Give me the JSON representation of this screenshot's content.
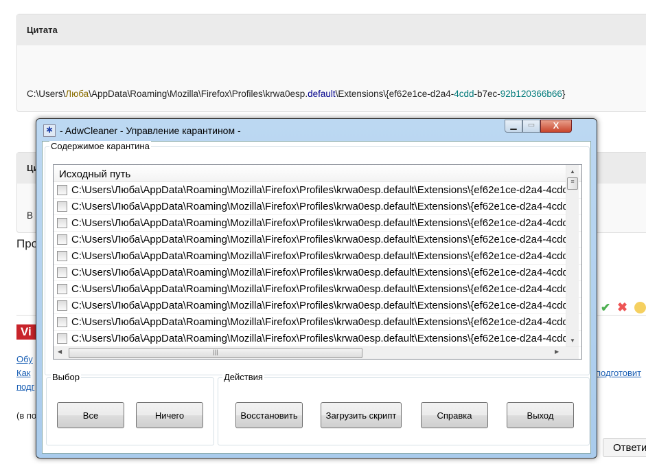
{
  "page": {
    "quote1": {
      "header": "Цитата",
      "path_parts": [
        "C:\\Users\\",
        "Люба",
        "\\AppData\\Roaming\\Mozilla\\Firefox\\Profiles\\krwa0esp.",
        "default",
        "\\Extensions\\{ef62e1ce-d2a4-",
        "4cdd",
        "-b7ec-",
        "92b120366b66",
        "}"
      ]
    },
    "quote2": {
      "header": "Ци",
      "text": "В"
    },
    "pro_text": "Про",
    "logo_text": "Vi",
    "links": [
      "Обу",
      "Как",
      "подг"
    ],
    "link_right": "подготовит",
    "paren_text": "(в по",
    "reply_button": "Ответи"
  },
  "dialog": {
    "title": "- AdwCleaner - Управление карантином -",
    "quarantine_group": "Содержимое карантина",
    "column_header": "Исходный путь",
    "rows": [
      "C:\\Users\\Люба\\AppData\\Roaming\\Mozilla\\Firefox\\Profiles\\krwa0esp.default\\Extensions\\{ef62e1ce-d2a4-4cdd",
      "C:\\Users\\Люба\\AppData\\Roaming\\Mozilla\\Firefox\\Profiles\\krwa0esp.default\\Extensions\\{ef62e1ce-d2a4-4cdd",
      "C:\\Users\\Люба\\AppData\\Roaming\\Mozilla\\Firefox\\Profiles\\krwa0esp.default\\Extensions\\{ef62e1ce-d2a4-4cdd",
      "C:\\Users\\Люба\\AppData\\Roaming\\Mozilla\\Firefox\\Profiles\\krwa0esp.default\\Extensions\\{ef62e1ce-d2a4-4cdd",
      "C:\\Users\\Люба\\AppData\\Roaming\\Mozilla\\Firefox\\Profiles\\krwa0esp.default\\Extensions\\{ef62e1ce-d2a4-4cdd",
      "C:\\Users\\Люба\\AppData\\Roaming\\Mozilla\\Firefox\\Profiles\\krwa0esp.default\\Extensions\\{ef62e1ce-d2a4-4cdd",
      "C:\\Users\\Люба\\AppData\\Roaming\\Mozilla\\Firefox\\Profiles\\krwa0esp.default\\Extensions\\{ef62e1ce-d2a4-4cdd",
      "C:\\Users\\Люба\\AppData\\Roaming\\Mozilla\\Firefox\\Profiles\\krwa0esp.default\\Extensions\\{ef62e1ce-d2a4-4cdd",
      "C:\\Users\\Люба\\AppData\\Roaming\\Mozilla\\Firefox\\Profiles\\krwa0esp.default\\Extensions\\{ef62e1ce-d2a4-4cdd",
      "C:\\Users\\Люба\\AppData\\Roaming\\Mozilla\\Firefox\\Profiles\\krwa0esp.default\\Extensions\\{ef62e1ce-d2a4-4cdd"
    ],
    "selection_group": "Выбор",
    "actions_group": "Действия",
    "buttons": {
      "all": "Все",
      "none": "Ничего",
      "restore": "Восстановить",
      "load_script": "Загрузить скрипт",
      "help": "Справка",
      "exit": "Выход"
    }
  }
}
